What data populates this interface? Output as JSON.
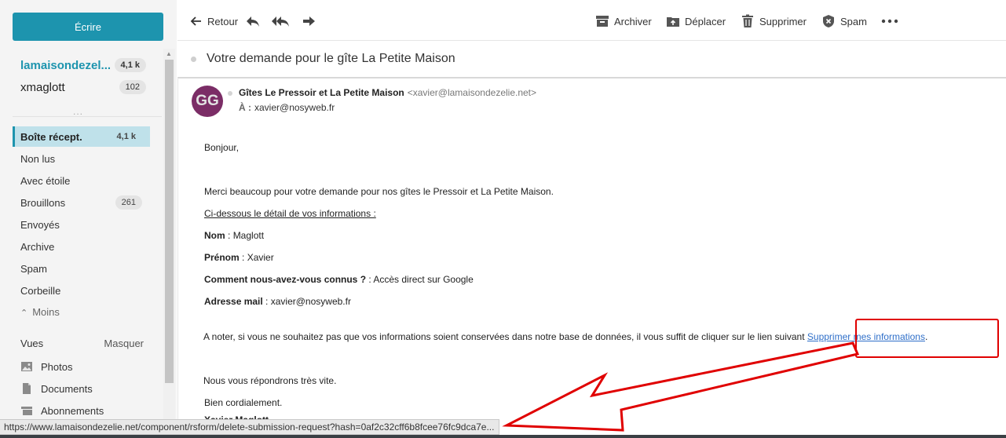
{
  "sidebar": {
    "compose_label": "Écrire",
    "accounts": [
      {
        "name": "lamaisondezel...",
        "count": "4,1 k"
      },
      {
        "name": "xmaglott",
        "count": "102"
      }
    ],
    "more_accounts": "...",
    "folders": [
      {
        "label": "Boîte récept.",
        "count": "4,1 k"
      },
      {
        "label": "Non lus",
        "count": ""
      },
      {
        "label": "Avec étoile",
        "count": ""
      },
      {
        "label": "Brouillons",
        "count": "261"
      },
      {
        "label": "Envoyés",
        "count": ""
      },
      {
        "label": "Archive",
        "count": ""
      },
      {
        "label": "Spam",
        "count": ""
      },
      {
        "label": "Corbeille",
        "count": ""
      }
    ],
    "less_label": "Moins",
    "views": {
      "title": "Vues",
      "hide_label": "Masquer",
      "items": [
        {
          "label": "Photos",
          "icon": "photo-icon"
        },
        {
          "label": "Documents",
          "icon": "document-icon"
        },
        {
          "label": "Abonnements",
          "icon": "subscription-icon"
        }
      ]
    }
  },
  "toolbar": {
    "back_label": "Retour",
    "archive_label": "Archiver",
    "move_label": "Déplacer",
    "delete_label": "Supprimer",
    "spam_label": "Spam"
  },
  "message": {
    "subject": "Votre demande pour le gîte La Petite Maison",
    "avatar_initials": "GG",
    "sender_name": "Gîtes Le Pressoir et La Petite Maison",
    "sender_email": "<xavier@lamaisondezelie.net>",
    "to_label": "À :",
    "to_value": "xavier@nosyweb.fr",
    "body": {
      "greeting": "Bonjour,",
      "thanks": "Merci beaucoup pour votre demande pour nos gîtes le Pressoir et La Petite Maison.",
      "details_intro": "Ci-dessous le détail de vos informations :",
      "fields": [
        {
          "label": "Nom",
          "value": "Maglott"
        },
        {
          "label": "Prénom",
          "value": "Xavier"
        },
        {
          "label": "Comment nous-avez-vous connus ?",
          "value": "Accès direct sur Google"
        },
        {
          "label": "Adresse mail",
          "value": "xavier@nosyweb.fr"
        }
      ],
      "note": "A noter, si vous ne souhaitez pas que vos informations soient conservées dans notre base de données, il vous suffit de cliquer sur le lien suivant ",
      "link_label": "Supprimer mes informations",
      "note_end": ".",
      "reply": "Nous vous répondrons très vite.",
      "closing": "Bien cordialement.",
      "signature": "Xavier Maglott"
    }
  },
  "statusbar": {
    "url": "https://www.lamaisondezelie.net/component/rsform/delete-submission-request?hash=0af2c32cff6b8fcee76fc9dca7e..."
  },
  "annotation_color": "#e00000",
  "accent_color": "#1d94ae"
}
